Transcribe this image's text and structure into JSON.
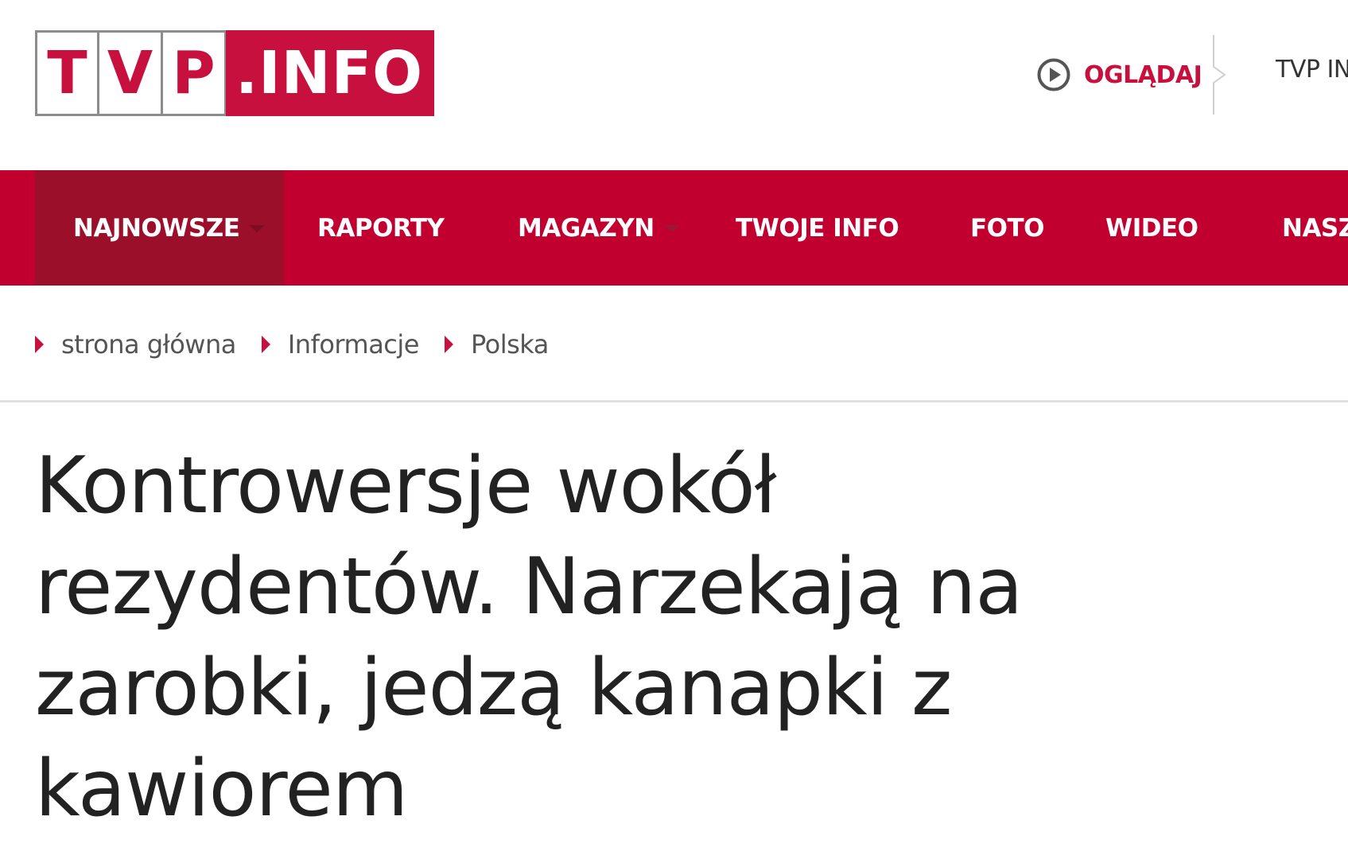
{
  "header": {
    "logo": {
      "letters": [
        "T",
        "V",
        "P"
      ],
      "suffix": ".INFO"
    },
    "watch": {
      "icon": "play-circle-icon",
      "label": "OGLĄDAJ"
    },
    "tvp_link_label": "TVP IN"
  },
  "nav": {
    "items": [
      {
        "label": "NAJNOWSZE",
        "active": true,
        "has_dropdown": true
      },
      {
        "label": "RAPORTY",
        "active": false,
        "has_dropdown": false
      },
      {
        "label": "MAGAZYN",
        "active": false,
        "has_dropdown": true
      },
      {
        "label": "TWOJE INFO",
        "active": false,
        "has_dropdown": false
      },
      {
        "label": "FOTO",
        "active": false,
        "has_dropdown": false
      },
      {
        "label": "WIDEO",
        "active": false,
        "has_dropdown": false
      },
      {
        "label": "NASZ",
        "active": false,
        "has_dropdown": false
      }
    ]
  },
  "breadcrumb": {
    "items": [
      {
        "label": "strona główna"
      },
      {
        "label": "Informacje"
      },
      {
        "label": "Polska"
      }
    ]
  },
  "article": {
    "title": "Kontrowersje wokół rezydentów. Narzekają na zarobki, jedzą kanapki z kawiorem"
  },
  "colors": {
    "brand_red": "#c8103e",
    "nav_red": "#c1002f",
    "nav_active": "#9c0f2a",
    "text": "#222222"
  }
}
